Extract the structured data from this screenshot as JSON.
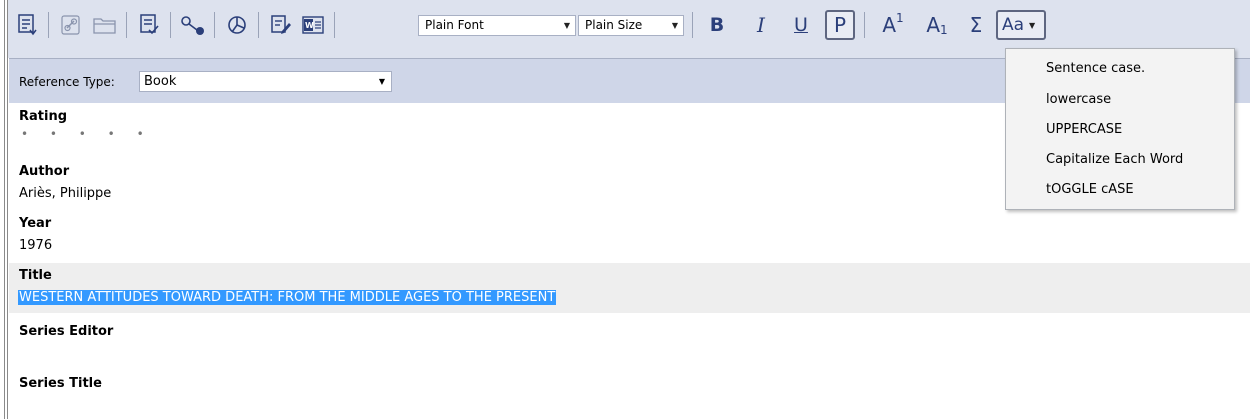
{
  "toolbar": {
    "font_select": "Plain Font",
    "size_select": "Plain Size",
    "bold_label": "B",
    "italic_label": "I",
    "underline_label": "U",
    "plain_label": "P",
    "superscript_label": "A",
    "superscript_mark": "1",
    "subscript_label": "A",
    "subscript_mark": "1",
    "symbol_label": "Σ",
    "case_label": "Aa",
    "icons": [
      "insert-citation-icon",
      "link-icon",
      "folder-icon",
      "format-bibliography-icon",
      "find-full-text-icon",
      "chart-icon",
      "edit-reference-icon",
      "word-icon"
    ]
  },
  "case_menu": {
    "items": [
      "Sentence case.",
      "lowercase",
      "UPPERCASE",
      "Capitalize Each Word",
      "tOGGLE cASE"
    ]
  },
  "reference": {
    "type_label": "Reference Type:",
    "type_value": "Book"
  },
  "fields": {
    "rating_label": "Rating",
    "rating_dots": "• • • • •",
    "author_label": "Author",
    "author_value": "Ariès, Philippe",
    "year_label": "Year",
    "year_value": "1976",
    "title_label": "Title",
    "title_value": "WESTERN ATTITUDES TOWARD DEATH: FROM THE MIDDLE AGES TO THE PRESENT",
    "series_editor_label": "Series Editor",
    "series_title_label": "Series Title"
  },
  "colors": {
    "toolbar_bg": "#dde2ee",
    "icon_blue": "#2b3f7a",
    "selection": "#3399ff",
    "ref_bar_bg": "#cfd6e8"
  }
}
